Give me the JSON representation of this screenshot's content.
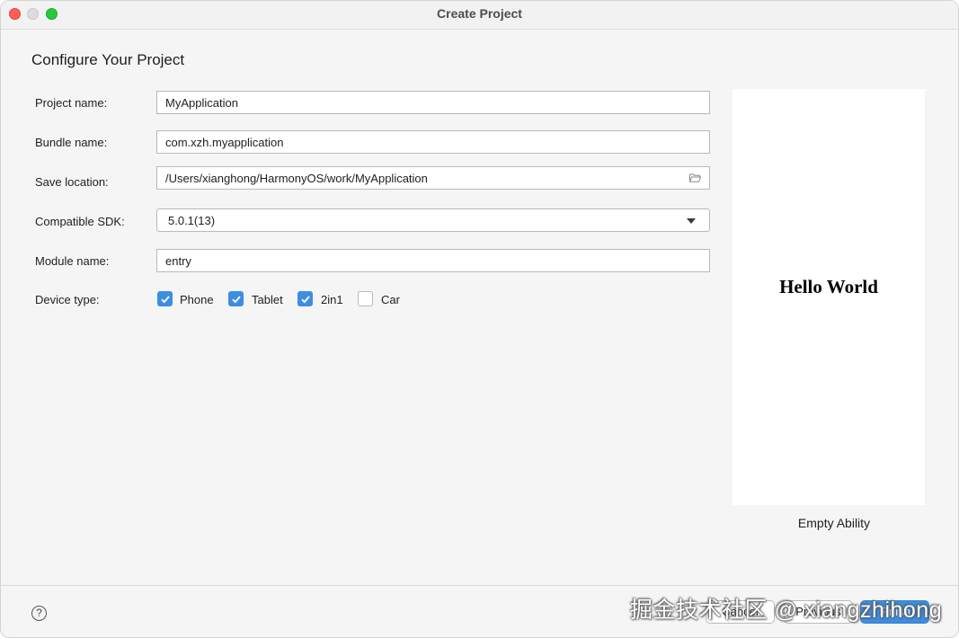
{
  "window": {
    "title": "Create Project"
  },
  "page": {
    "heading": "Configure Your Project"
  },
  "form": {
    "project_name": {
      "label": "Project name:",
      "value": "MyApplication"
    },
    "bundle_name": {
      "label": "Bundle name:",
      "value": "com.xzh.myapplication"
    },
    "save_location": {
      "label": "Save location:",
      "value": "/Users/xianghong/HarmonyOS/work/MyApplication",
      "icon": "folder-icon"
    },
    "compatible_sdk": {
      "label": "Compatible SDK:",
      "value": "5.0.1(13)",
      "icon": "chevron-down-icon"
    },
    "module_name": {
      "label": "Module name:",
      "value": "entry"
    },
    "device_type": {
      "label": "Device type:",
      "options": [
        {
          "label": "Phone",
          "checked": true
        },
        {
          "label": "Tablet",
          "checked": true
        },
        {
          "label": "2in1",
          "checked": true
        },
        {
          "label": "Car",
          "checked": false
        }
      ]
    }
  },
  "preview": {
    "text": "Hello World",
    "template_name": "Empty Ability"
  },
  "footer": {
    "help_icon": "?",
    "cancel_label": "Cancel",
    "previous_label": "Previous",
    "finish_label": "Finish"
  },
  "watermark": {
    "text": "掘金技术社区 @ xiangzhihong"
  },
  "colors": {
    "accent": "#3d8ee0",
    "window_bg": "#f5f5f5",
    "close": "#fe5f57",
    "zoom": "#28c840"
  }
}
